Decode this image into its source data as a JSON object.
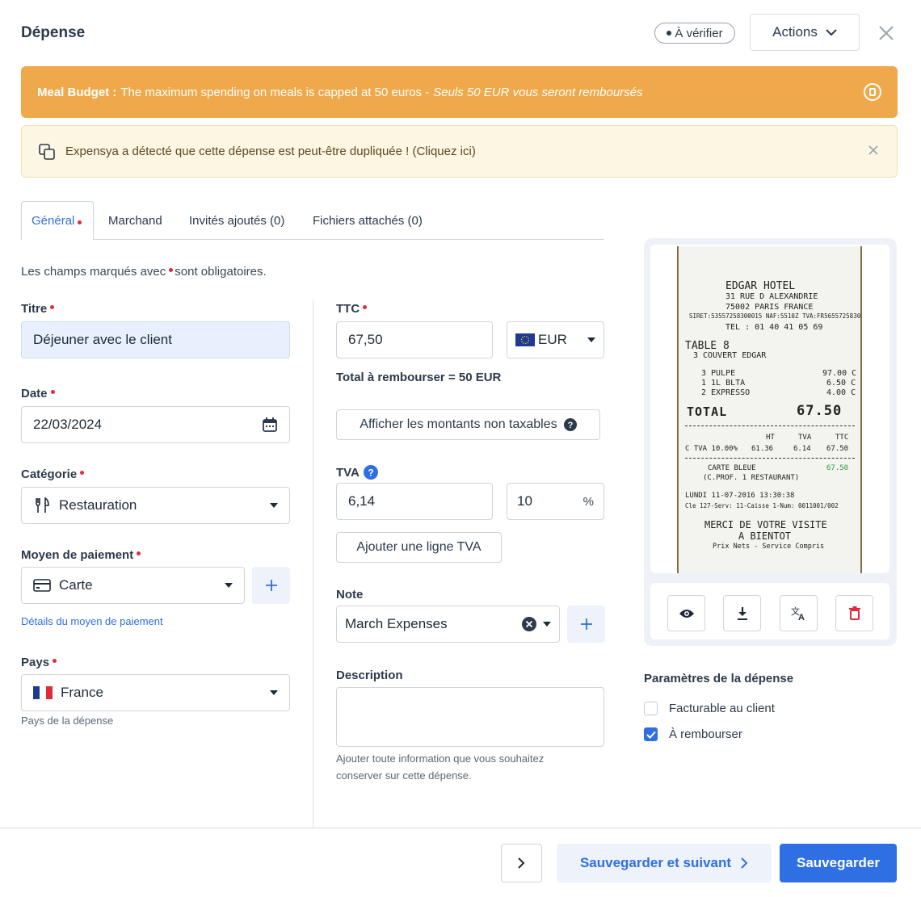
{
  "header": {
    "title": "Dépense",
    "status_badge": "À vérifier",
    "actions_label": "Actions"
  },
  "banners": {
    "budget_title": "Meal Budget :",
    "budget_text": "The maximum spending on meals is capped at 50 euros -",
    "budget_note": "Seuls 50 EUR vous seront remboursés",
    "duplicate_text": "Expensya a détecté que cette dépense est peut-être dupliquée ! (Cliquez ici)"
  },
  "tabs": [
    {
      "label": "Général"
    },
    {
      "label": "Marchand"
    },
    {
      "label": "Invités ajoutés (0)"
    },
    {
      "label": "Fichiers attachés (0)"
    }
  ],
  "required_note": {
    "before": "Les champs marqués avec",
    "after": "sont obligatoires."
  },
  "form": {
    "title_label": "Titre",
    "title_value": "Déjeuner avec le client",
    "date_label": "Date",
    "date_value": "22/03/2024",
    "category_label": "Catégorie",
    "category_value": "Restauration",
    "payment_label": "Moyen de paiement",
    "payment_value": "Carte",
    "payment_details_link": "Détails du moyen de paiement",
    "country_label": "Pays",
    "country_value": "France",
    "country_hint": "Pays de la dépense",
    "ttc_label": "TTC",
    "ttc_value": "67,50",
    "currency_value": "EUR",
    "total_refund": "Total à rembourser = 50 EUR",
    "show_non_taxable": "Afficher les montants non taxables",
    "tva_label": "TVA",
    "tva_value": "6,14",
    "tva_rate": "10",
    "tva_unit": "%",
    "add_tva_line": "Ajouter une ligne TVA",
    "note_label": "Note",
    "note_value": "March Expenses",
    "description_label": "Description",
    "description_value": "",
    "description_hint_1": "Ajouter toute information que vous souhaitez",
    "description_hint_2": "conserver sur cette dépense."
  },
  "receipt": {
    "lines": [
      "EDGAR HOTEL",
      "31 RUE D ALEXANDRIE",
      "75002 PARIS FRANCE",
      "SIRET:53557258300015 NAF:5510Z TVA:FR56557258300",
      "TEL : 01 40 41 05 69",
      "TABLE    8",
      "3 COUVERT  EDGAR",
      "3 PULPE",
      "97.00 C",
      "1 1L BLTA",
      "6.50 C",
      "2 EXPRESSO",
      "4.00 C",
      "TOTAL",
      "67.50",
      "HT",
      "TVA",
      "TTC",
      "C TVA 10.00%",
      "61.36",
      "6.14",
      "67.50",
      "CARTE BLEUE",
      "67.50",
      "(C.PROF. 1 RESTAURANT)",
      "LUNDI 11-07-2016 13:30:38",
      "Cle 127-Serv: 11-Caisse  1-Num: 0011001/002",
      "MERCI DE VOTRE VISITE",
      "A BIENTOT",
      "Prix Nets - Service Compris"
    ]
  },
  "settings": {
    "title": "Paramètres de la dépense",
    "billable_label": "Facturable au client",
    "billable_checked": false,
    "refund_label": "À rembourser",
    "refund_checked": true
  },
  "footer": {
    "save_next_label": "Sauvegarder et suivant",
    "save_label": "Sauvegarder"
  },
  "colors": {
    "primary": "#2f6fe4",
    "warning_banner": "#f0a94a",
    "info_banner": "#fdf6e3",
    "required": "#e02b3c"
  }
}
